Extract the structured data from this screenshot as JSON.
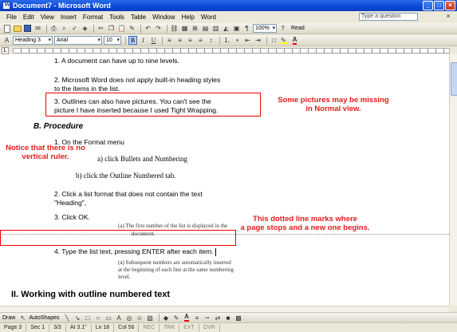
{
  "window": {
    "title": "Document7 - Microsoft Word",
    "help_placeholder": "Type a question"
  },
  "menu": [
    "File",
    "Edit",
    "View",
    "Insert",
    "Format",
    "Tools",
    "Table",
    "Window",
    "Help",
    "Word"
  ],
  "toolbar_standard": {
    "read_label": "Read"
  },
  "toolbar_formatting": {
    "style": "Heading 3",
    "font": "Arial",
    "size": "10",
    "bold": "B",
    "italic": "I",
    "underline": "U"
  },
  "ruler": {
    "corner_symbol": "L"
  },
  "document": {
    "line1": "1.  A document can have up to nine levels.",
    "line2a": "2.  Microsoft Word does not apply built-in heading styles",
    "line2b": "to the items in the list.",
    "line3a": "3.  Outlines can also have pictures. You can't see the",
    "line3b": "picture I have inserted because I used Tight Wrapping.",
    "section_b": "B. Procedure",
    "step1": "1.  On the Format menu",
    "step1a": "a)  click Bullets and Numbering",
    "step1b": "b)  click the Outline Numbered tab.",
    "step2a": "2.  Click a list format that does not contain the text",
    "step2b": "\"Heading\",",
    "step3": "3.  Click OK.",
    "step3a_line1": "(a)  The first number of the list is displayed in the",
    "step3a_line2": "document.",
    "step4": "4.  Type the list text, pressing ENTER after each item.",
    "step4a_line1": "(a)  Subsequent numbers are automatically inserted",
    "step4a_line2": "at the beginning of each line at the same numbering",
    "step4a_line3": "level.",
    "section_ii": "II. Working with outline numbered text"
  },
  "annotations": {
    "pictures_line1": "Some pictures may be missing",
    "pictures_line2": "in Normal view.",
    "ruler_line1": "Notice that there is no",
    "ruler_line2": "vertical ruler.",
    "pagebreak_line1": "This dotted line marks where",
    "pagebreak_line2": "a page stops and a new one begins."
  },
  "drawing_toolbar": {
    "draw_label": "Draw",
    "autoshapes_label": "AutoShapes"
  },
  "status": {
    "page": "Page 3",
    "sec": "Sec 1",
    "page_of": "3/3",
    "at": "At 3.1\"",
    "ln": "Ln 18",
    "col": "Col 56",
    "rec": "REC",
    "trk": "TRK",
    "ext": "EXT",
    "ovr": "OVR"
  },
  "colors": {
    "title_bar": "#0a48d6",
    "annotation_red": "#e41b1b"
  }
}
